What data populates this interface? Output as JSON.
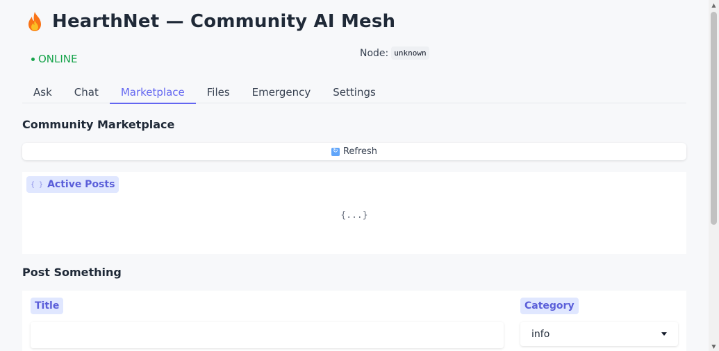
{
  "header": {
    "app_icon": "fire-icon",
    "title": "HearthNet — Community AI Mesh",
    "status": "ONLINE",
    "node_label": "Node:",
    "node_value": "unknown"
  },
  "tabs": [
    {
      "label": "Ask",
      "active": false
    },
    {
      "label": "Chat",
      "active": false
    },
    {
      "label": "Marketplace",
      "active": true
    },
    {
      "label": "Files",
      "active": false
    },
    {
      "label": "Emergency",
      "active": false
    },
    {
      "label": "Settings",
      "active": false
    }
  ],
  "marketplace": {
    "heading": "Community Marketplace",
    "refresh_icon": "refresh-icon",
    "refresh_label": "Refresh",
    "posts_label": "Active Posts",
    "posts_icon": "braces-icon",
    "posts_value": "{...}"
  },
  "post_form": {
    "heading": "Post Something",
    "title_label": "Title",
    "title_value": "",
    "category_label": "Category",
    "category_value": "info"
  },
  "colors": {
    "accent": "#6366f1",
    "status_online": "#16a34a",
    "label_pill_bg": "#e0e7ff"
  }
}
